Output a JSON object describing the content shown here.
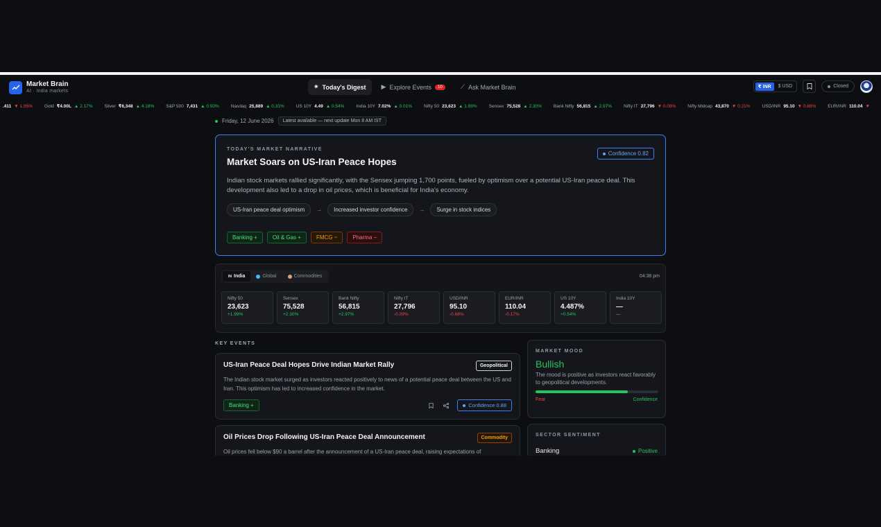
{
  "app": {
    "title": "Market Brain",
    "subtitle": "AI · India markets"
  },
  "nav": {
    "tabs": [
      {
        "label": "Today's Digest",
        "active": true
      },
      {
        "label": "Explore Events",
        "badge": "10"
      },
      {
        "label": "Ask Market Brain"
      }
    ],
    "currency": {
      "inr": "₹ INR",
      "usd": "$ USD"
    },
    "market_status": "Closed"
  },
  "ticker": [
    {
      "name": "",
      "value": ".411",
      "change": "▼ 1.95%",
      "dir": "down"
    },
    {
      "name": "Gold",
      "value": "₹4.00L",
      "change": "▲ 2.17%",
      "dir": "up"
    },
    {
      "name": "Silver",
      "value": "₹6,348",
      "change": "▲ 4.18%",
      "dir": "up"
    },
    {
      "name": "S&P 500",
      "value": "7,431",
      "change": "▲ 0.50%",
      "dir": "up"
    },
    {
      "name": "Nasdaq",
      "value": "25,889",
      "change": "▲ 0.31%",
      "dir": "up"
    },
    {
      "name": "US 10Y",
      "value": "4.49",
      "change": "▲ 0.54%",
      "dir": "up"
    },
    {
      "name": "India 10Y",
      "value": "7.02%",
      "change": "▲ 0.01%",
      "dir": "up"
    },
    {
      "name": "Nifty 50",
      "value": "23,623",
      "change": "▲ 1.99%",
      "dir": "up"
    },
    {
      "name": "Sensex",
      "value": "75,528",
      "change": "▲ 2.30%",
      "dir": "up"
    },
    {
      "name": "Bank Nifty",
      "value": "56,815",
      "change": "▲ 2.97%",
      "dir": "up"
    },
    {
      "name": "Nifty IT",
      "value": "27,796",
      "change": "▼ 0.09%",
      "dir": "down"
    },
    {
      "name": "Nifty Midcap",
      "value": "43,870",
      "change": "▼ 0.21%",
      "dir": "down"
    },
    {
      "name": "USD/INR",
      "value": "95.10",
      "change": "▼ 0.68%",
      "dir": "down"
    },
    {
      "name": "EUR/INR",
      "value": "110.04",
      "change": "▼",
      "dir": "down"
    }
  ],
  "date": {
    "text": "Friday, 12 June 2026",
    "badge": "Latest available — next update Mon 8 AM IST"
  },
  "narrative": {
    "eyebrow": "TODAY'S MARKET NARRATIVE",
    "confidence": "Confidence 0.82",
    "title": "Market Soars on US-Iran Peace Hopes",
    "body": "Indian stock markets rallied significantly, with the Sensex jumping 1,700 points, fueled by optimism over a potential US-Iran peace deal. This development also led to a drop in oil prices, which is beneficial for India's economy.",
    "chain": [
      "US-Iran peace deal optimism",
      "Increased investor confidence",
      "Surge in stock indices"
    ],
    "arrow": "→",
    "sectors": [
      {
        "label": "Banking +",
        "tone": "green"
      },
      {
        "label": "Oil & Gas +",
        "tone": "green"
      },
      {
        "label": "FMCG ~",
        "tone": "amber"
      },
      {
        "label": "Pharma −",
        "tone": "red"
      }
    ]
  },
  "markets": {
    "tabs": [
      {
        "label": "India",
        "flag": "IN",
        "active": true
      },
      {
        "label": "Global"
      },
      {
        "label": "Commodities"
      }
    ],
    "time": "04:38 pm",
    "cards": [
      {
        "name": "Nifty 50",
        "value": "23,623",
        "change": "+1.99%",
        "dir": "up"
      },
      {
        "name": "Sensex",
        "value": "75,528",
        "change": "+2.30%",
        "dir": "up"
      },
      {
        "name": "Bank Nifty",
        "value": "56,815",
        "change": "+2.97%",
        "dir": "up"
      },
      {
        "name": "Nifty IT",
        "value": "27,796",
        "change": "-0.09%",
        "dir": "down"
      },
      {
        "name": "USD/INR",
        "value": "95.10",
        "change": "-0.68%",
        "dir": "down"
      },
      {
        "name": "EUR/INR",
        "value": "110.04",
        "change": "-0.17%",
        "dir": "down"
      },
      {
        "name": "US 10Y",
        "value": "4.487%",
        "change": "+0.54%",
        "dir": "up"
      },
      {
        "name": "India 10Y",
        "value": "—",
        "change": "—",
        "dir": "flat"
      }
    ]
  },
  "key_events": {
    "label": "KEY EVENTS",
    "items": [
      {
        "title": "US-Iran Peace Deal Hopes Drive Indian Market Rally",
        "category": "Geopolitical",
        "body": "The Indian stock market surged as investors reacted positively to news of a potential peace deal between the US and Iran. This optimism has led to increased confidence in the market.",
        "tag": "Banking +",
        "confidence": "Confidence 0.88"
      },
      {
        "title": "Oil Prices Drop Following US-Iran Peace Deal Announcement",
        "category": "Commodity",
        "body": "Oil prices fell below $90 a barrel after the announcement of a US-Iran peace deal, raising expectations of"
      }
    ]
  },
  "mood": {
    "label": "MARKET MOOD",
    "title": "Bullish",
    "body": "The mood is positive as investors react favorably to geopolitical developments.",
    "level": 0.75,
    "left": "Fear",
    "right": "Confidence"
  },
  "sentiment": {
    "label": "SECTOR SENTIMENT",
    "rows": [
      {
        "sector": "Banking",
        "status": "Positive"
      }
    ]
  },
  "colors": {
    "accent": "#2563eb",
    "up": "#22c55e",
    "down": "#ef4444",
    "amber": "#f59e0b"
  }
}
